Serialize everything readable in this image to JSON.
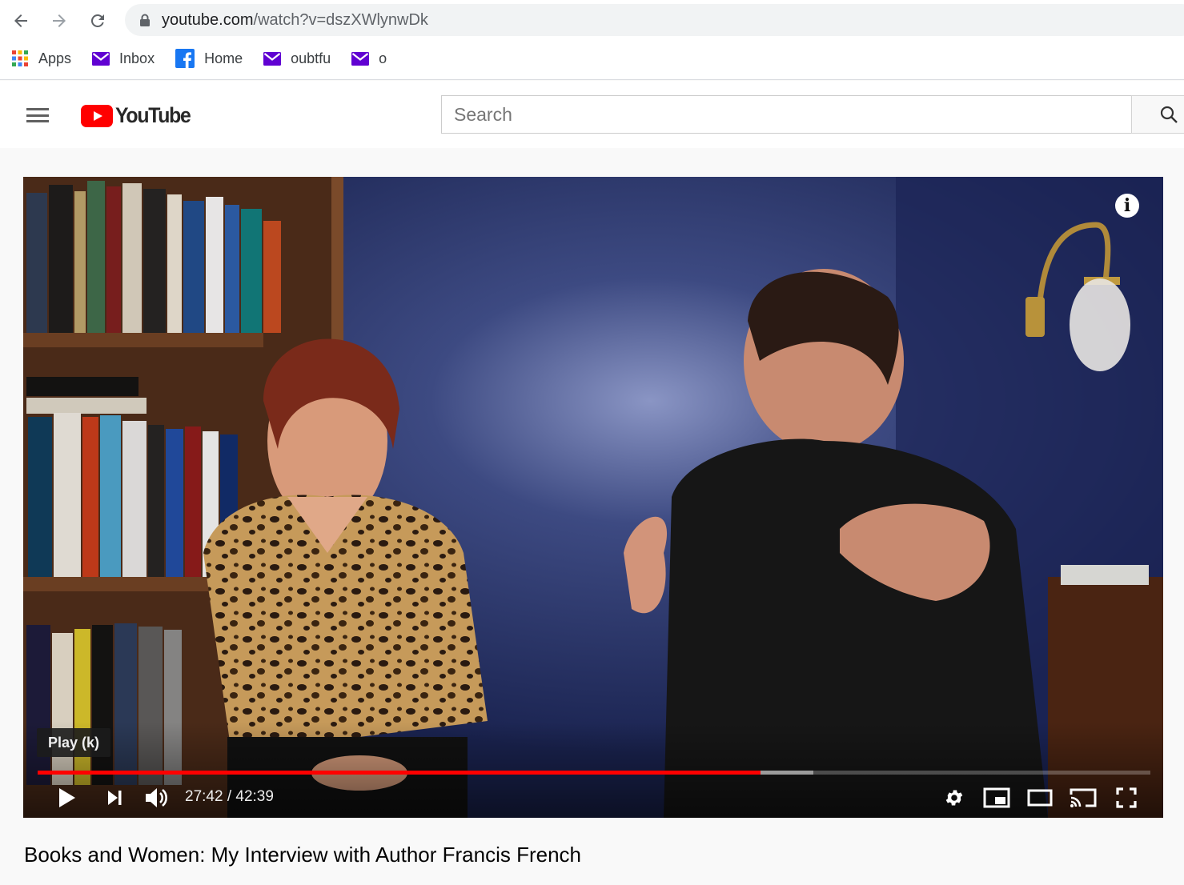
{
  "browser": {
    "url_host": "youtube.com",
    "url_path": "/watch?v=dszXWlynwDk",
    "bookmarks": [
      {
        "label": "Apps",
        "icon": "apps-grid-icon"
      },
      {
        "label": "Inbox",
        "icon": "yahoo-mail-icon"
      },
      {
        "label": "Home",
        "icon": "facebook-icon"
      },
      {
        "label": "oubtfu",
        "icon": "yahoo-mail-icon"
      },
      {
        "label": "o",
        "icon": "yahoo-mail-icon"
      }
    ]
  },
  "header": {
    "logo_text": "YouTube",
    "search_placeholder": "Search"
  },
  "player": {
    "tooltip": "Play (k)",
    "current_time": "27:42",
    "duration": "42:39",
    "time_display": "27:42 / 42:39",
    "played_fraction": 0.6497,
    "buffered_fraction": 0.697,
    "progress_color": "#ff0000"
  },
  "video": {
    "title": "Books and Women: My Interview with Author Francis French"
  },
  "colors": {
    "yt_red": "#ff0000",
    "yahoo_purple": "#6001d2",
    "facebook_blue": "#1877f2"
  }
}
